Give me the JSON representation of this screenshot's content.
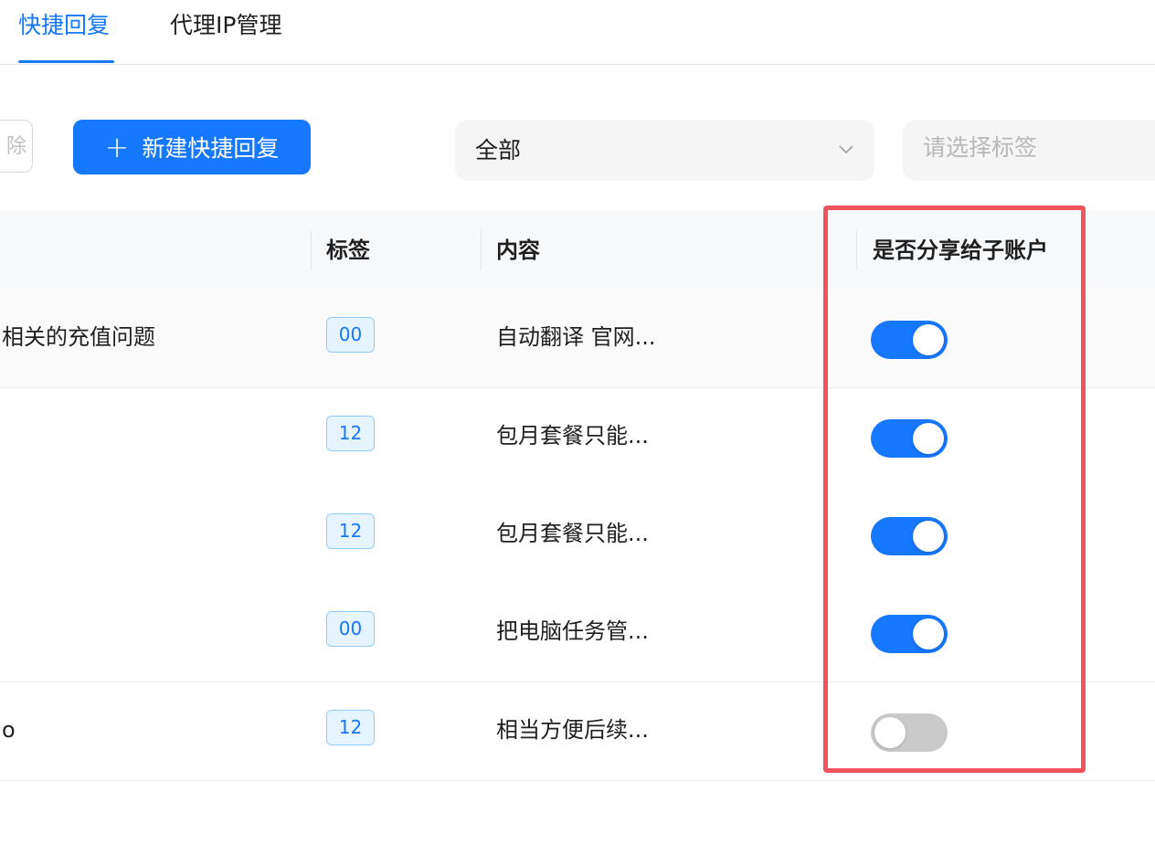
{
  "tabs": [
    {
      "label": "快捷回复",
      "active": true
    },
    {
      "label": "代理IP管理",
      "active": false
    }
  ],
  "toolbar": {
    "ghost_button_partial": "除",
    "new_button_icon": "+",
    "new_button_label": "新建快捷回复",
    "filter_value": "全部",
    "tag_placeholder": "请选择标签"
  },
  "table": {
    "headers": {
      "tag": "标签",
      "content": "内容",
      "share": "是否分享给子账户"
    },
    "rows": [
      {
        "title": "相关的充值问题",
        "tag": "00",
        "content": "自动翻译 官网...",
        "shared": true
      },
      {
        "title": "",
        "tag": "12",
        "content": "包月套餐只能...",
        "shared": true
      },
      {
        "title": "",
        "tag": "12",
        "content": "包月套餐只能...",
        "shared": true
      },
      {
        "title": "",
        "tag": "00",
        "content": "把电脑任务管...",
        "shared": true
      },
      {
        "title": "o",
        "tag": "12",
        "content": "相当方便后续...",
        "shared": false
      }
    ]
  },
  "colors": {
    "accent": "#1677ff",
    "highlight_border": "#f0555f",
    "switch_off": "#c9c9c9"
  }
}
